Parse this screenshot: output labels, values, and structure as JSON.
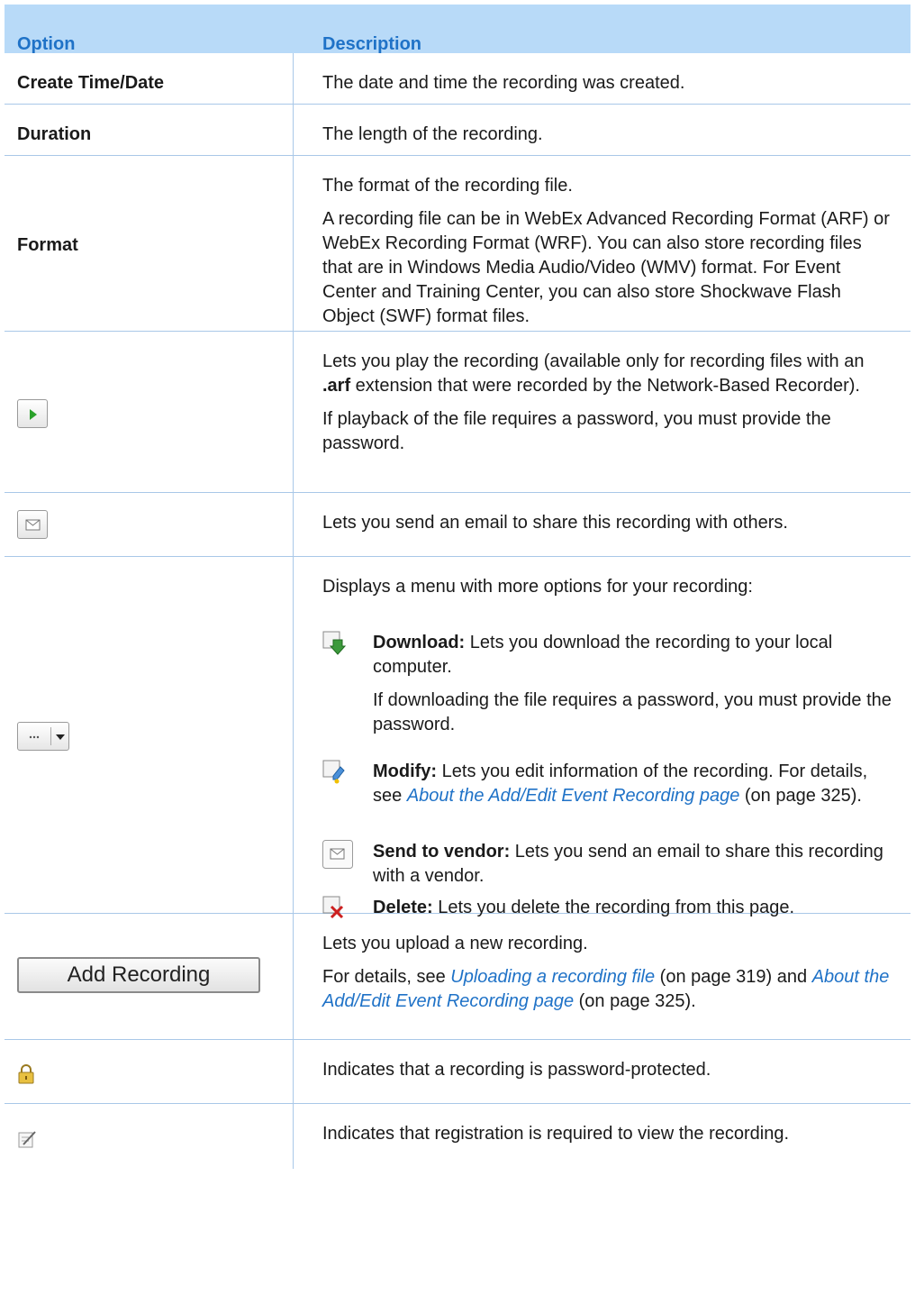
{
  "header": {
    "option": "Option",
    "description": "Description"
  },
  "rows": {
    "create": {
      "label": "Create Time/Date",
      "desc": "The date and time the recording was created."
    },
    "duration": {
      "label": "Duration",
      "desc": "The length of the recording."
    },
    "format": {
      "label": "Format",
      "desc1": "The format of the recording file.",
      "desc2": "A recording file can be in WebEx Advanced Recording Format (ARF) or WebEx Recording Format (WRF). You can also store recording files that are in Windows Media Audio/Video (WMV) format. For Event Center and Training Center, you can also store Shockwave Flash Object (SWF) format files."
    },
    "play": {
      "desc1_a": "Lets you play the recording (available only for recording files with an ",
      "desc1_b": ".arf",
      "desc1_c": " extension that were recorded by the Network-Based Recorder).",
      "desc2": "If playback of the file requires a password, you must provide the password."
    },
    "email": {
      "desc": "Lets you send an email to share this recording with others."
    },
    "more": {
      "desc": "Displays a menu with more options for your recording:",
      "download": {
        "title": "Download:",
        "text": " Lets you download the recording to your local computer.",
        "text2": "If downloading the file requires a password, you must provide the password."
      },
      "modify": {
        "title": "Modify:",
        "text_a": " Lets you edit information of the recording. For details, see ",
        "link": "About the Add/Edit Event Recording page",
        "text_b": " (on page 325)."
      },
      "vendor": {
        "title": "Send to vendor:",
        "text": " Lets you send an email to share this recording with a vendor."
      },
      "delete": {
        "title": "Delete:",
        "text": " Lets you delete the recording from this page."
      }
    },
    "add": {
      "button": "Add Recording",
      "desc1": "Lets you upload a new recording.",
      "desc2_a": "For details, see ",
      "link1": "Uploading a recording file",
      "desc2_b": " (on page 319) and ",
      "link2": "About the Add/Edit Event Recording page",
      "desc2_c": " (on page 325)."
    },
    "lock": {
      "desc": "Indicates that a recording is password-protected."
    },
    "registration": {
      "desc": "Indicates that registration is required to view the recording."
    }
  }
}
